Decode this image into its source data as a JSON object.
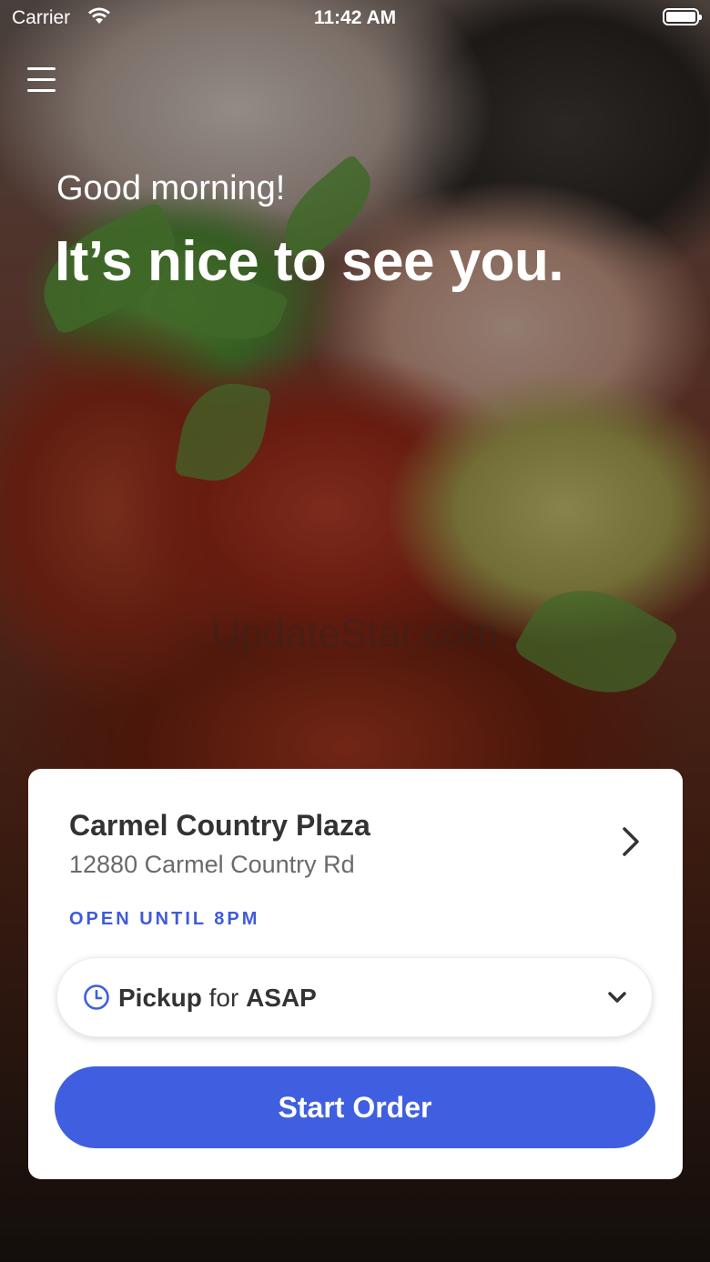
{
  "status_bar": {
    "carrier": "Carrier",
    "time": "11:42 AM"
  },
  "header": {
    "greeting": "Good morning!",
    "headline": "It’s nice to see you."
  },
  "watermark": "UpdateStar.com",
  "store": {
    "name": "Carmel Country Plaza",
    "address": "12880 Carmel Country Rd",
    "hours": "OPEN UNTIL 8PM"
  },
  "order_mode": {
    "mode": "Pickup",
    "connector": "for",
    "time": "ASAP"
  },
  "start_button_label": "Start Order",
  "colors": {
    "accent": "#3f5fe0",
    "hours_text": "#3f5bd9"
  }
}
